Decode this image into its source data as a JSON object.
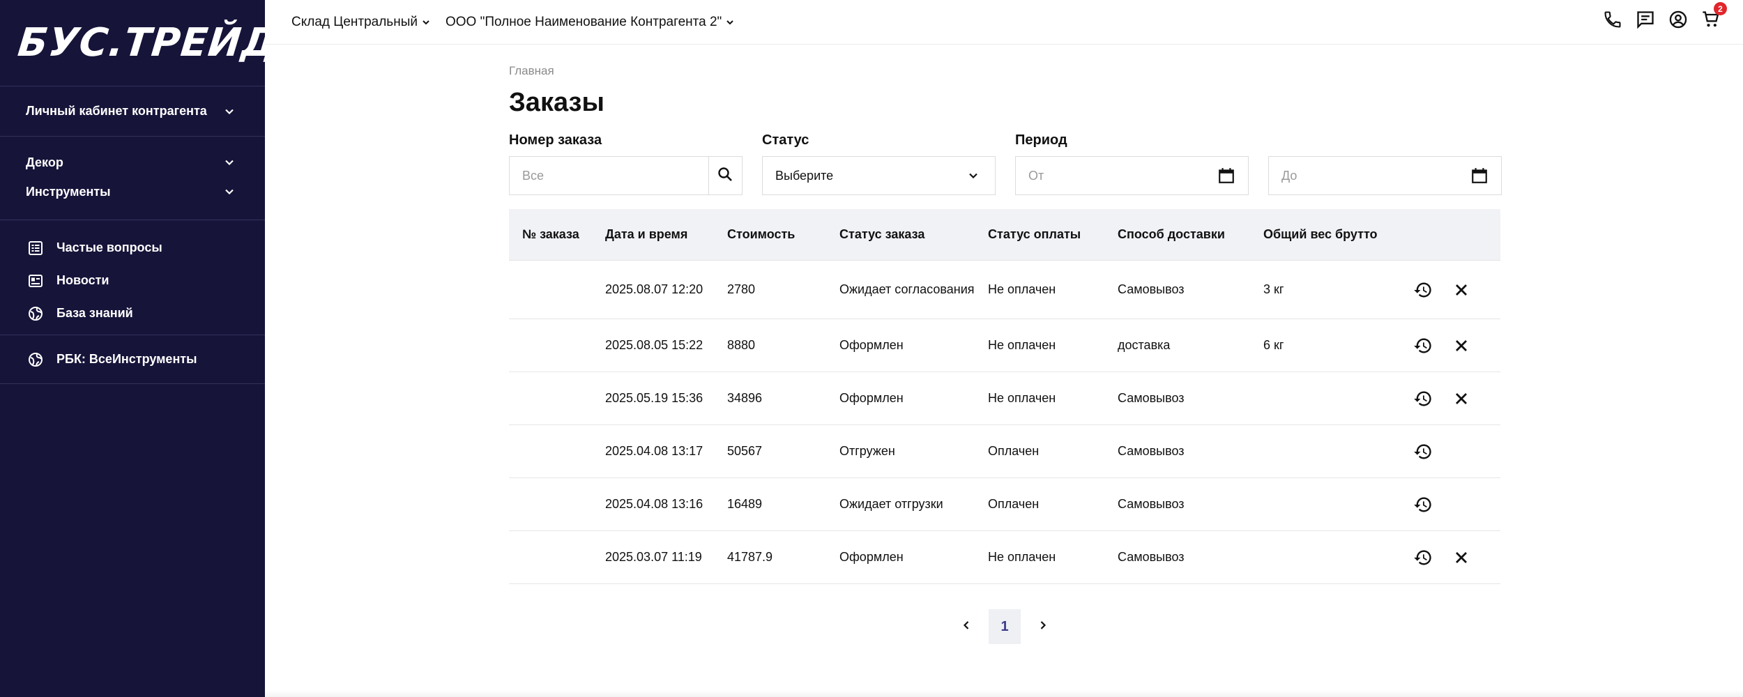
{
  "brand": {
    "logo_text": "БУС.ТРЕЙД"
  },
  "sidebar": {
    "cabinet": "Личный кабинет контрагента",
    "catalog": [
      {
        "label": "Декор"
      },
      {
        "label": "Инструменты"
      }
    ],
    "links": [
      {
        "label": "Частые вопросы",
        "icon": "faq-icon"
      },
      {
        "label": "Новости",
        "icon": "news-icon"
      },
      {
        "label": "База знаний",
        "icon": "globe-icon"
      }
    ],
    "external": {
      "label": "РБК: ВсеИнструменты",
      "icon": "globe-icon"
    }
  },
  "topbar": {
    "warehouse": "Склад Центральный",
    "counterparty": "ООО \"Полное Наименование Контрагента 2\"",
    "cart_count": "2"
  },
  "breadcrumb": "Главная",
  "page_title": "Заказы",
  "filters": {
    "order_number": {
      "label": "Номер заказа",
      "placeholder": "Все"
    },
    "status": {
      "label": "Статус",
      "value": "Выберите"
    },
    "period": {
      "label": "Период",
      "from_placeholder": "От",
      "to_placeholder": "До"
    }
  },
  "table": {
    "headers": [
      "№ заказа",
      "Дата и время",
      "Стоимость",
      "Статус заказа",
      "Статус оплаты",
      "Способ доставки",
      "Общий вес брутто"
    ],
    "rows": [
      {
        "number": "",
        "datetime": "2025.08.07 12:20",
        "cost": "2780",
        "status": "Ожидает согласования",
        "payment": "Не оплачен",
        "delivery": "Самовывоз",
        "weight": "3 кг",
        "cancel": true
      },
      {
        "number": "",
        "datetime": "2025.08.05 15:22",
        "cost": "8880",
        "status": "Оформлен",
        "payment": "Не оплачен",
        "delivery": "доставка",
        "weight": "6 кг",
        "cancel": true
      },
      {
        "number": "",
        "datetime": "2025.05.19 15:36",
        "cost": "34896",
        "status": "Оформлен",
        "payment": "Не оплачен",
        "delivery": "Самовывоз",
        "weight": "",
        "cancel": true
      },
      {
        "number": "",
        "datetime": "2025.04.08 13:17",
        "cost": "50567",
        "status": "Отгружен",
        "payment": "Оплачен",
        "delivery": "Самовывоз",
        "weight": "",
        "cancel": false
      },
      {
        "number": "",
        "datetime": "2025.04.08 13:16",
        "cost": "16489",
        "status": "Ожидает отгрузки",
        "payment": "Оплачен",
        "delivery": "Самовывоз",
        "weight": "",
        "cancel": false
      },
      {
        "number": "",
        "datetime": "2025.03.07 11:19",
        "cost": "41787.9",
        "status": "Оформлен",
        "payment": "Не оплачен",
        "delivery": "Самовывоз",
        "weight": "",
        "cancel": true
      }
    ]
  },
  "pagination": {
    "current": "1"
  },
  "colors": {
    "sidebar_bg": "#161439",
    "badge": "#e0262b",
    "page_accent": "#3b3d8a"
  }
}
